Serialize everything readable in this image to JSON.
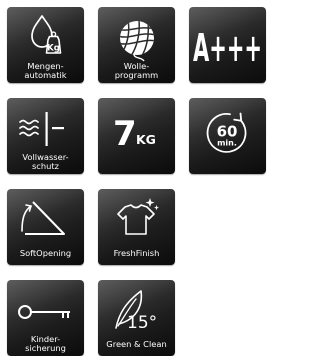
{
  "features": [
    {
      "id": "mengenautomatik",
      "icon": "weight-drop-icon",
      "lines": [
        "Mengen-",
        "automatik"
      ],
      "unit": "Kg"
    },
    {
      "id": "wolleprogramm",
      "icon": "yarn-ball-icon",
      "lines": [
        "Wolle-",
        "programm"
      ]
    },
    {
      "id": "energy",
      "icon": "energy-class-icon",
      "text": "A+++"
    },
    {
      "id": "vollwasserschutz",
      "icon": "water-protection-icon",
      "lines": [
        "Vollwasser-",
        "schutz"
      ]
    },
    {
      "id": "capacity",
      "icon": "capacity-icon",
      "value": "7",
      "unit": "KG"
    },
    {
      "id": "quick",
      "icon": "timer-icon",
      "value": "60",
      "unit": "min."
    },
    {
      "id": "softopening",
      "icon": "door-opening-icon",
      "lines": [
        "SoftOpening"
      ]
    },
    {
      "id": "freshfinish",
      "icon": "shirt-sparkle-icon",
      "lines": [
        "FreshFinish"
      ]
    },
    {
      "id": "kindersicherung",
      "icon": "key-icon",
      "lines": [
        "Kinder-",
        "sicherung"
      ]
    },
    {
      "id": "greenclean",
      "icon": "leaf-icon",
      "value": "15°",
      "lines": [
        "Green & Clean"
      ]
    }
  ]
}
